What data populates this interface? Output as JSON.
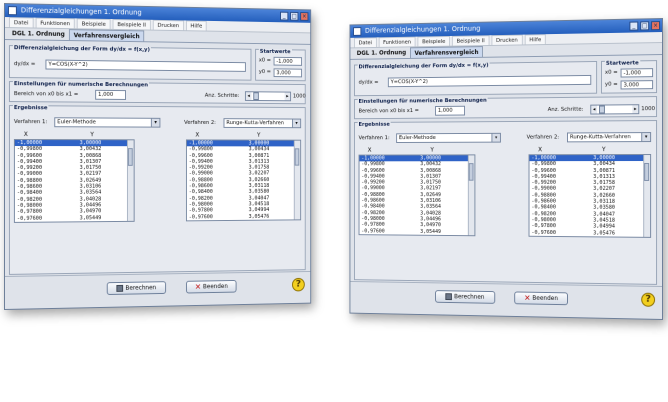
{
  "app": {
    "title": "Differenzialgleichungen 1. Ordnung",
    "menu": [
      "Datei",
      "Funktionen",
      "Beispiele",
      "Beispiele II",
      "Drucken",
      "Hilfe"
    ],
    "tabs": [
      "DGL 1. Ordnung",
      "Verfahrensvergleich"
    ],
    "active_tab": 1
  },
  "equation": {
    "group_title": "Differenzialgleichung der Form dy/dx = f(x,y)",
    "label": "dy/dx =",
    "value": "Y=COS(X-Y^2)"
  },
  "startwerte": {
    "group_title": "Startwerte",
    "x0_label": "x0 =",
    "x0_value": "-1,000",
    "y0_label": "y0 =",
    "y0_value": "3,000"
  },
  "settings": {
    "group_title": "Einstellungen für numerische Berechnungen",
    "range_label": "Bereich von x0 bis x1 =",
    "range_value": "1,000",
    "steps_label": "Anz. Schritte:",
    "steps_value": "1000"
  },
  "results": {
    "group_title": "Ergebnisse",
    "method1_label": "Verfahren 1:",
    "method1_value": "Euler-Methode",
    "method2_label": "Verfahren 2:",
    "method2_value": "Runge-Kutta-Verfahren",
    "col_x": "X",
    "col_y": "Y",
    "x_values": [
      "-1,00000",
      "-0,99800",
      "-0,99600",
      "-0,99400",
      "-0,99200",
      "-0,99000",
      "-0,98800",
      "-0,98600",
      "-0,98400",
      "-0,98200",
      "-0,98000",
      "-0,97800",
      "-0,97600"
    ],
    "y_euler": [
      "3,00000",
      "3,00432",
      "3,00868",
      "3,01307",
      "3,01750",
      "3,02197",
      "3,02649",
      "3,03106",
      "3,03564",
      "3,04028",
      "3,04496",
      "3,04970",
      "3,05449"
    ],
    "y_rk": [
      "3,00000",
      "3,00434",
      "3,00871",
      "3,01313",
      "3,01758",
      "3,02207",
      "3,02660",
      "3,03118",
      "3,03580",
      "3,04047",
      "3,04518",
      "3,04994",
      "3,05476"
    ]
  },
  "buttons": {
    "calc": "Berechnen",
    "close": "Beenden",
    "help": "?"
  }
}
